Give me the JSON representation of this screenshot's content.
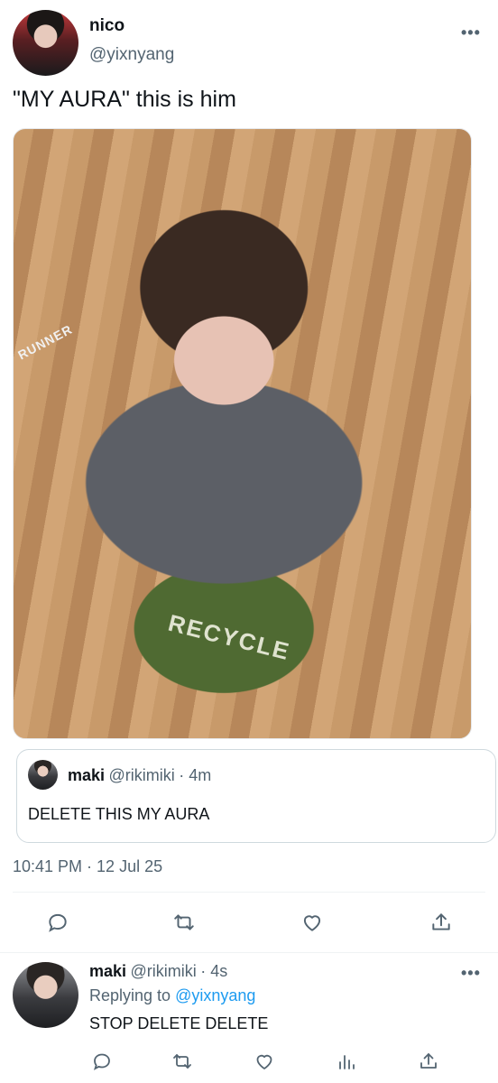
{
  "tweet": {
    "author_name": "nico",
    "author_handle": "@yixnyang",
    "more_icon": "more-icon",
    "text": "\"MY AURA\" this is him",
    "timestamp": "10:41 PM · 12 Jul 25",
    "image_text": "RUNNER",
    "image_text_2": "RECYCLE"
  },
  "quote": {
    "name": "maki",
    "handle": "@rikimiki",
    "time": "· 4m",
    "text": "DELETE THIS MY AURA"
  },
  "actions": [
    "reply-icon",
    "retweet-icon",
    "like-icon",
    "share-icon"
  ],
  "reply": {
    "name": "maki",
    "handle": "@rikimiki",
    "time": "· 4s",
    "replying_prefix": "Replying to",
    "replying_to": "@yixnyang",
    "text": "STOP DELETE DELETE",
    "actions": [
      "reply-icon",
      "retweet-icon",
      "like-icon",
      "views-icon",
      "share-icon"
    ]
  },
  "colors": {
    "link": "#1d9bf0",
    "secondary_text": "#536471",
    "border": "#cfd9de"
  }
}
